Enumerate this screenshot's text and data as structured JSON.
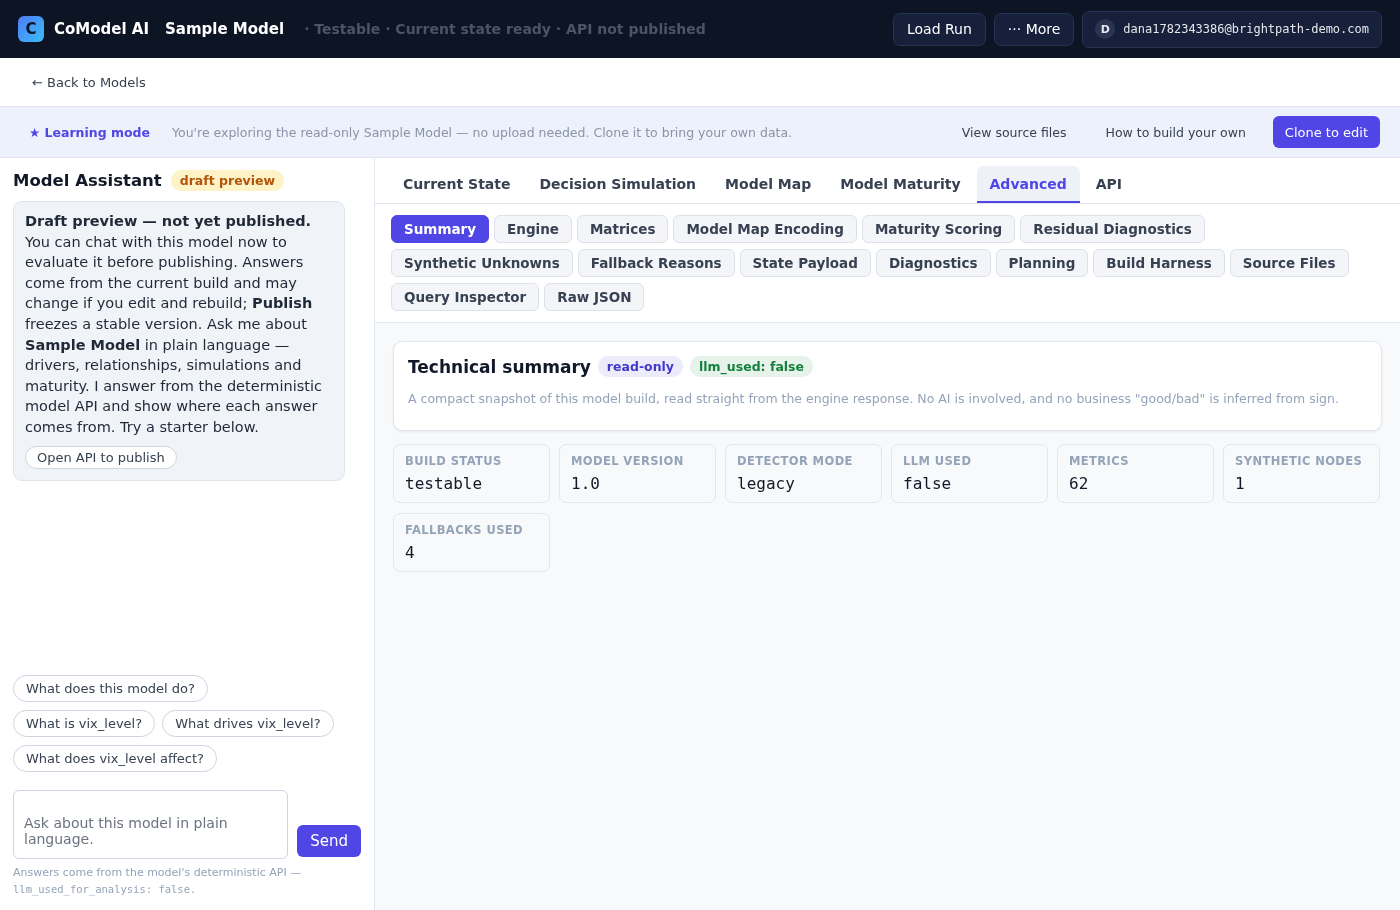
{
  "header": {
    "logo_letter": "C",
    "brand": "CoModel AI",
    "model_name": "Sample Model",
    "status": "· Testable · Current state ready · API not published",
    "buttons": [
      {
        "label": "Load Run"
      },
      {
        "label": "··· More"
      }
    ],
    "account": {
      "initial": "D",
      "email": "dana1782343386@brightpath-demo.com"
    }
  },
  "back_link": "← Back to Models",
  "banner": {
    "title": "★ Learning mode",
    "message": "You're exploring the read-only Sample Model — no upload needed. Clone it to bring your own data.",
    "links": [
      "View source files",
      "How to build your own"
    ],
    "primary_button": "Clone to edit"
  },
  "assistant": {
    "title": "Model Assistant",
    "badge": "draft preview",
    "intro": "**Draft preview — not yet published.** You can chat with this model now to evaluate it before publishing. Answers come from the current build and may change if you edit and rebuild; **Publish** freezes a stable version. Ask me about **Sample Model** in plain language — drivers, relationships, simulations and maturity. I answer from the deterministic model API and show where each answer comes from. Try a starter below.",
    "intro_button": "Open API to publish",
    "starters": [
      "What does this model do?",
      "What is vix_level?",
      "What drives vix_level?",
      "What does vix_level affect?"
    ],
    "input": {
      "placeholder": "Ask about this model in plain language."
    },
    "send": "Send",
    "footnote": "Answers come from the model's deterministic API —",
    "footnote_code": "llm_used_for_analysis: false."
  },
  "tabs": [
    {
      "label": "Current State",
      "selected": false
    },
    {
      "label": "Decision Simulation",
      "selected": false
    },
    {
      "label": "Model Map",
      "selected": false
    },
    {
      "label": "Model Maturity",
      "selected": false
    },
    {
      "label": "Advanced",
      "selected": true
    },
    {
      "label": "API",
      "selected": false
    }
  ],
  "subtabs": [
    {
      "label": "Summary",
      "selected": true
    },
    {
      "label": "Engine",
      "selected": false
    },
    {
      "label": "Matrices",
      "selected": false
    },
    {
      "label": "Model Map Encoding",
      "selected": false
    },
    {
      "label": "Maturity Scoring",
      "selected": false
    },
    {
      "label": "Residual Diagnostics",
      "selected": false
    },
    {
      "label": "Synthetic Unknowns",
      "selected": false
    },
    {
      "label": "Fallback Reasons",
      "selected": false
    },
    {
      "label": "State Payload",
      "selected": false
    },
    {
      "label": "Diagnostics",
      "selected": false
    },
    {
      "label": "Planning",
      "selected": false
    },
    {
      "label": "Build Harness",
      "selected": false
    },
    {
      "label": "Source Files",
      "selected": false
    },
    {
      "label": "Query Inspector",
      "selected": false
    },
    {
      "label": "Raw JSON",
      "selected": false
    }
  ],
  "summary": {
    "title": "Technical summary",
    "badges": [
      {
        "label": "read-only",
        "color": "#4338ca"
      },
      {
        "label": "llm_used: false",
        "color": "#15803d"
      }
    ],
    "description": "A compact snapshot of this model build, read straight from the engine response. No AI is involved, and no business \"good/bad\" is inferred from sign."
  },
  "stats": [
    {
      "label": "BUILD STATUS",
      "value": "testable"
    },
    {
      "label": "MODEL VERSION",
      "value": "1.0"
    },
    {
      "label": "DETECTOR MODE",
      "value": "legacy"
    },
    {
      "label": "LLM USED",
      "value": "false"
    },
    {
      "label": "METRICS",
      "value": "62"
    },
    {
      "label": "SYNTHETIC NODES",
      "value": "1"
    },
    {
      "label": "FALLBACKS USED",
      "value": "4"
    }
  ]
}
